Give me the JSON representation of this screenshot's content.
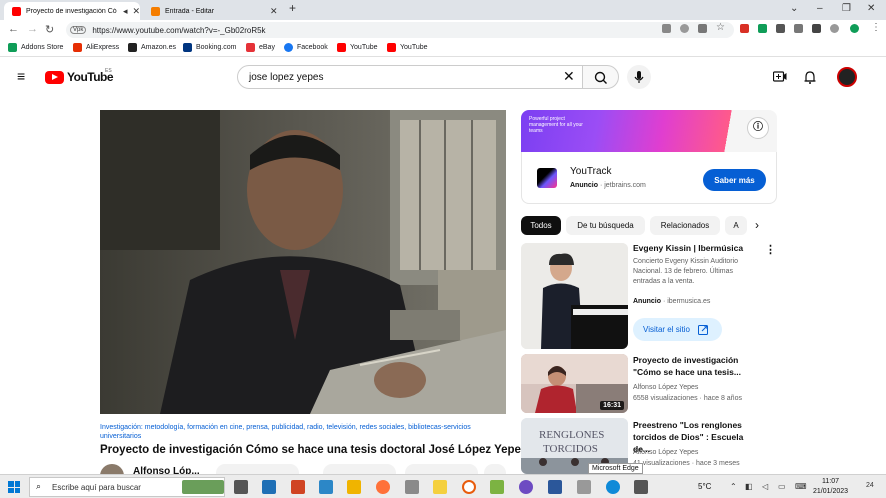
{
  "browser": {
    "tabs": [
      {
        "title": "Proyecto de investigación Có",
        "color": "#ff0000"
      },
      {
        "title": "Entrada - Editar",
        "color": "#f57d00"
      }
    ],
    "new_tab": "+",
    "url_badge": "Vpk",
    "url": "https://www.youtube.com/watch?v=-_Gb02roR5k",
    "bookmarks": [
      {
        "label": "Addons Store",
        "color": "#0f9d58"
      },
      {
        "label": "AliExpress",
        "color": "#e62e04"
      },
      {
        "label": "Amazon.es",
        "color": "#222222"
      },
      {
        "label": "Booking.com",
        "color": "#003580"
      },
      {
        "label": "eBay",
        "color": "#e53238"
      },
      {
        "label": "Facebook",
        "color": "#1877f2"
      },
      {
        "label": "YouTube",
        "color": "#ff0000"
      },
      {
        "label": "YouTube",
        "color": "#ff0000"
      }
    ]
  },
  "youtube": {
    "logo_text": "YouTube",
    "country_code": "ES",
    "search_value": "jose lopez yepes"
  },
  "video": {
    "tags": "Investigación: metodología, formación en cine, prensa, publicidad, radio, televisión, redes sociales, bibliotecas-servicios universitarios",
    "title": "Proyecto de investigación Cómo se hace una tesis doctoral José López Yepes",
    "channel": "Alfonso Lóp..."
  },
  "ad": {
    "banner_text": "Powerful project management for all your teams",
    "name": "YouTrack",
    "label": "Anuncio",
    "domain": "jetbrains.com",
    "cta": "Saber más",
    "info_icon": "info-icon"
  },
  "chips": [
    "Todos",
    "De tu búsqueda",
    "Relacionados",
    "A"
  ],
  "recommendations": [
    {
      "title": "Evgeny Kissin | Ibermúsica",
      "description": "Concierto Evgeny Kissin Auditorio Nacional. 13 de febrero. Últimas entradas a la venta.",
      "label": "Anuncio",
      "domain": "ibermusica.es",
      "cta": "Visitar el sitio"
    },
    {
      "title": "Proyecto de investigación \"Cómo se hace una tesis...",
      "channel": "Alfonso López Yepes",
      "meta": "6558 visualizaciones · hace 8 años",
      "duration": "16:31"
    },
    {
      "title": "Preestreno \"Los renglones torcidos de Dios\" : Escuela de...",
      "channel": "Alfonso López Yepes",
      "meta": "41 visualizaciones · hace 3 meses"
    }
  ],
  "tooltip": "Microsoft Edge",
  "taskbar": {
    "search_placeholder": "Escribe aquí para buscar",
    "weather": "5°C",
    "time": "11:07",
    "date": "21/01/2023",
    "notif_count": "24"
  }
}
